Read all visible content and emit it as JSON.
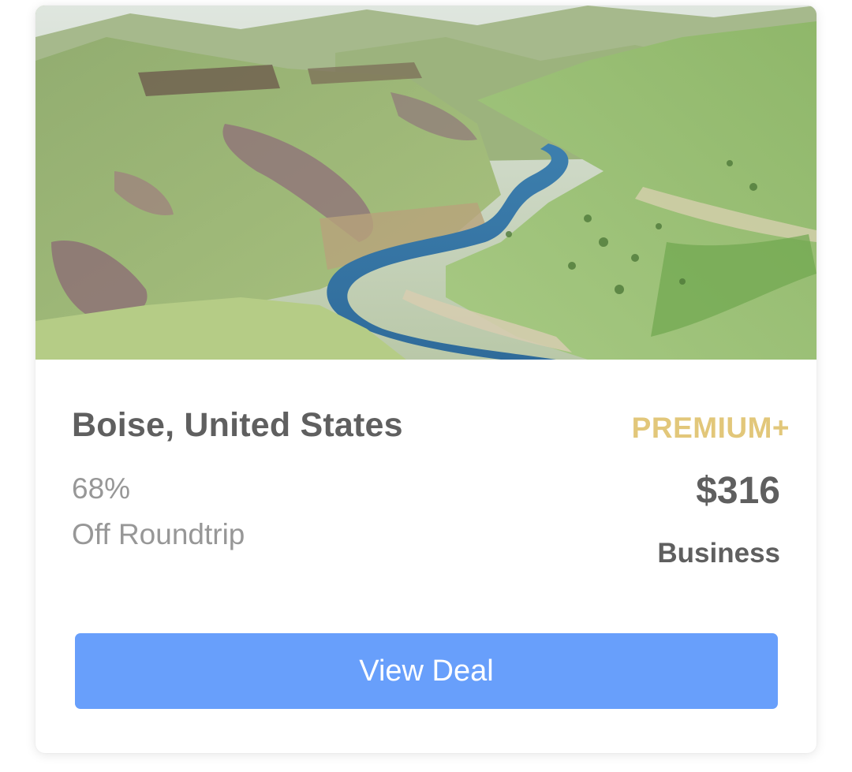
{
  "deal": {
    "image": "landscape-photo",
    "destination": "Boise, United States",
    "tier": "PREMIUM+",
    "discount": "68%",
    "discount_desc": "Off Roundtrip",
    "price": "$316",
    "cabin": "Business",
    "cta_label": "View Deal"
  },
  "colors": {
    "title": "#5f5f5f",
    "muted": "#979797",
    "tier": "#e2c77a",
    "button": "#689ffb",
    "button_text": "#ffffff"
  }
}
